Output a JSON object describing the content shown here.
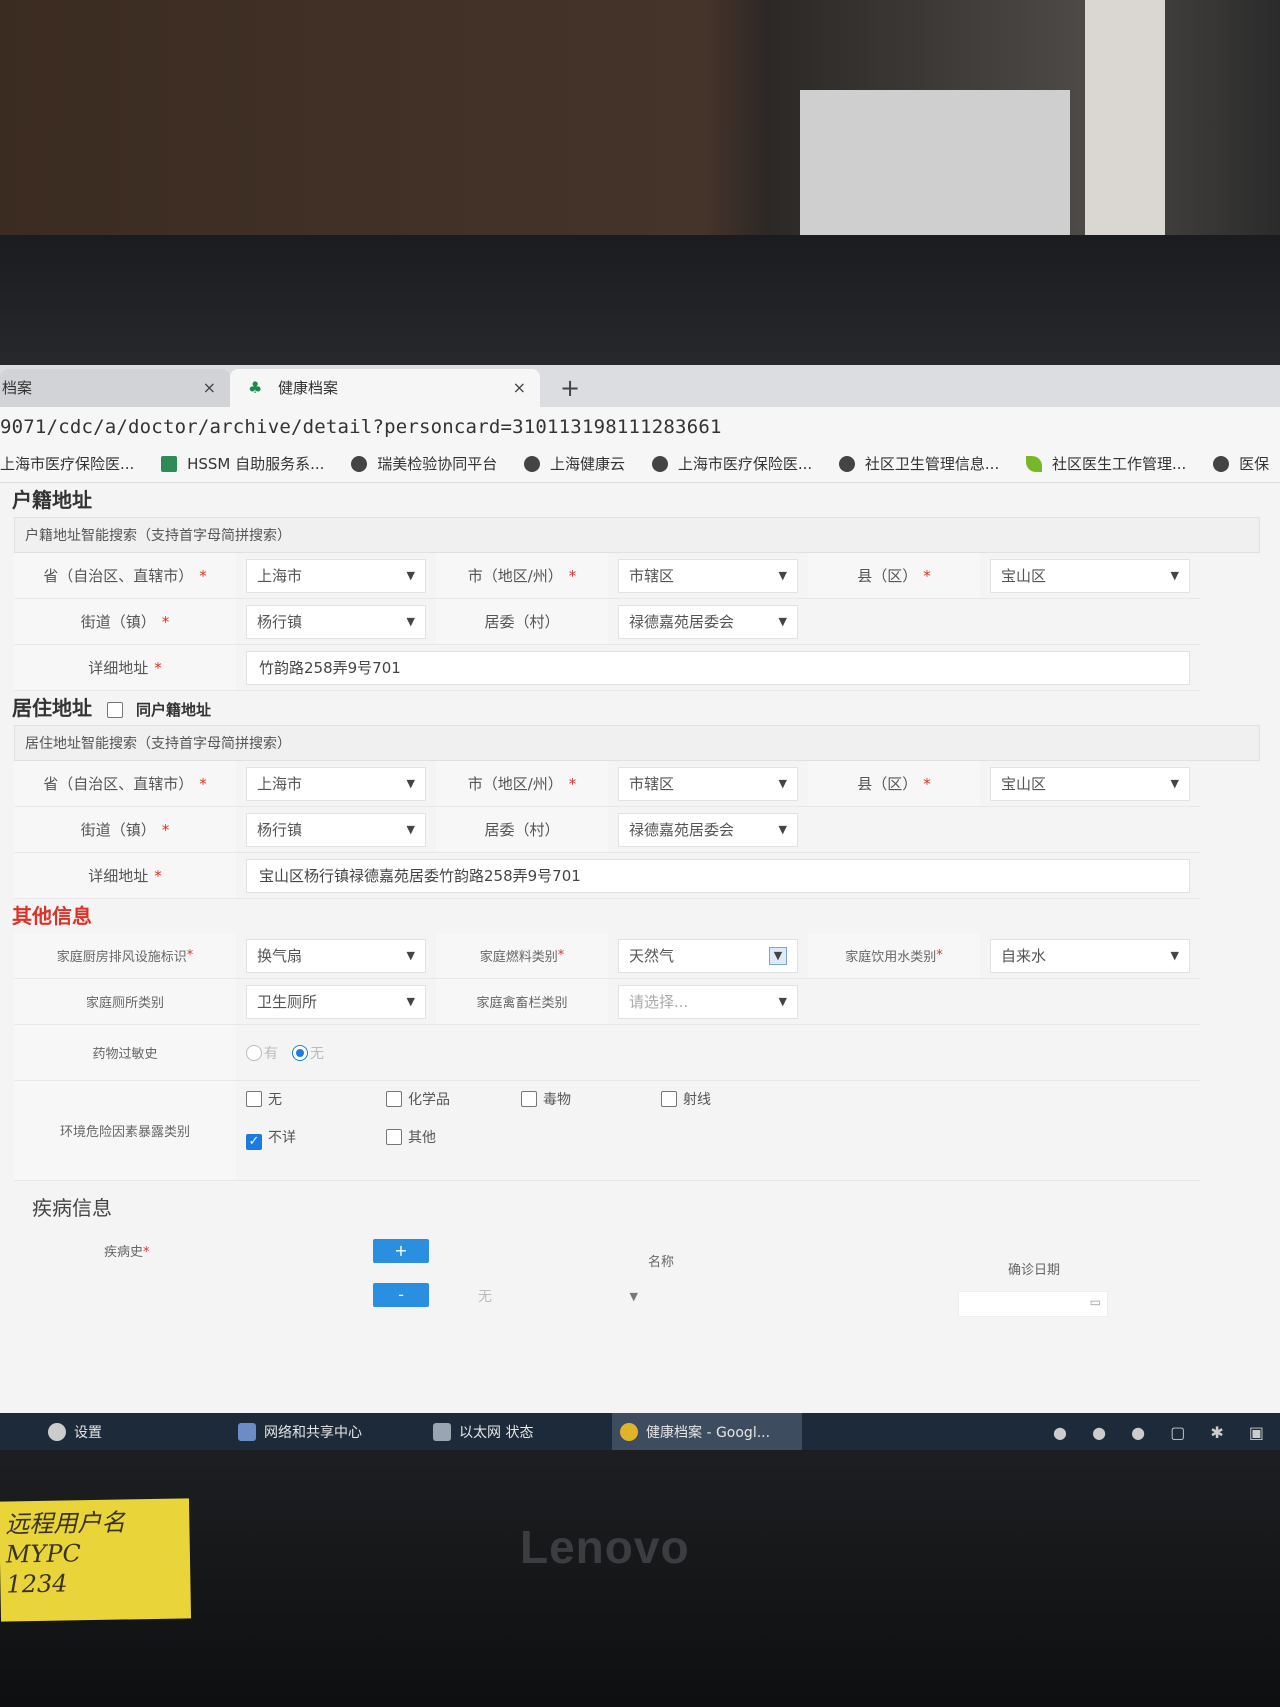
{
  "browser": {
    "tabs": [
      {
        "label": "档案",
        "close": "×"
      },
      {
        "label": "健康档案",
        "close": "×"
      }
    ],
    "new_tab": "+",
    "address": "9071/cdc/a/doctor/archive/detail?personcard=310113198111283661",
    "bookmarks": [
      {
        "label": "上海市医疗保险医...",
        "icon": "globe-icon"
      },
      {
        "label": "HSSM 自助服务系...",
        "icon": "app-icon"
      },
      {
        "label": "瑞美检验协同平台",
        "icon": "globe-icon"
      },
      {
        "label": "上海健康云",
        "icon": "globe-icon"
      },
      {
        "label": "上海市医疗保险医...",
        "icon": "globe-icon"
      },
      {
        "label": "社区卫生管理信息...",
        "icon": "globe-icon"
      },
      {
        "label": "社区医生工作管理...",
        "icon": "leaf-icon"
      },
      {
        "label": "医保",
        "icon": "globe-icon"
      }
    ]
  },
  "huji": {
    "title": "户籍地址",
    "search_placeholder": "户籍地址智能搜索（支持首字母简拼搜索）",
    "province_label": "省（自治区、直辖市）",
    "province_value": "上海市",
    "city_label": "市（地区/州）",
    "city_value": "市辖区",
    "county_label": "县（区）",
    "county_value": "宝山区",
    "street_label": "街道（镇）",
    "street_value": "杨行镇",
    "committee_label": "居委（村）",
    "committee_value": "禄德嘉苑居委会",
    "detail_label": "详细地址",
    "detail_value": "竹韵路258弄9号701"
  },
  "juzhu": {
    "title": "居住地址",
    "same_label": "同户籍地址",
    "search_placeholder": "居住地址智能搜索（支持首字母简拼搜索）",
    "province_label": "省（自治区、直辖市）",
    "province_value": "上海市",
    "city_label": "市（地区/州）",
    "city_value": "市辖区",
    "county_label": "县（区）",
    "county_value": "宝山区",
    "street_label": "街道（镇）",
    "street_value": "杨行镇",
    "committee_label": "居委（村）",
    "committee_value": "禄德嘉苑居委会",
    "detail_label": "详细地址",
    "detail_value": "宝山区杨行镇禄德嘉苑居委竹韵路258弄9号701"
  },
  "other": {
    "title": "其他信息",
    "kitchen_label": "家庭厨房排风设施标识",
    "kitchen_value": "换气扇",
    "fuel_label": "家庭燃料类别",
    "fuel_value": "天然气",
    "water_label": "家庭饮用水类别",
    "water_value": "自来水",
    "toilet_label": "家庭厕所类别",
    "toilet_value": "卫生厕所",
    "livestock_label": "家庭禽畜栏类别",
    "livestock_placeholder": "请选择...",
    "allergy_label": "药物过敏史",
    "allergy_yes": "有",
    "allergy_no": "无",
    "exposure_label": "环境危险因素暴露类别",
    "exposure_options": [
      {
        "label": "无",
        "checked": false
      },
      {
        "label": "化学品",
        "checked": false
      },
      {
        "label": "毒物",
        "checked": false
      },
      {
        "label": "射线",
        "checked": false
      },
      {
        "label": "不详",
        "checked": true
      },
      {
        "label": "其他",
        "checked": false
      }
    ]
  },
  "disease": {
    "title": "疾病信息",
    "history_label": "疾病史",
    "add_label": "+",
    "remove_label": "-",
    "col_name": "名称",
    "col_date": "确诊日期",
    "row_value": "无"
  },
  "required_mark": "*",
  "taskbar": {
    "settings": "设置",
    "network": "网络和共享中心",
    "ethernet": "以太网 状态",
    "chrome": "健康档案 - Googl..."
  },
  "monitor_brand": "Lenovo",
  "sticky_note": [
    "远程用户名",
    "MYPC",
    "1234"
  ]
}
